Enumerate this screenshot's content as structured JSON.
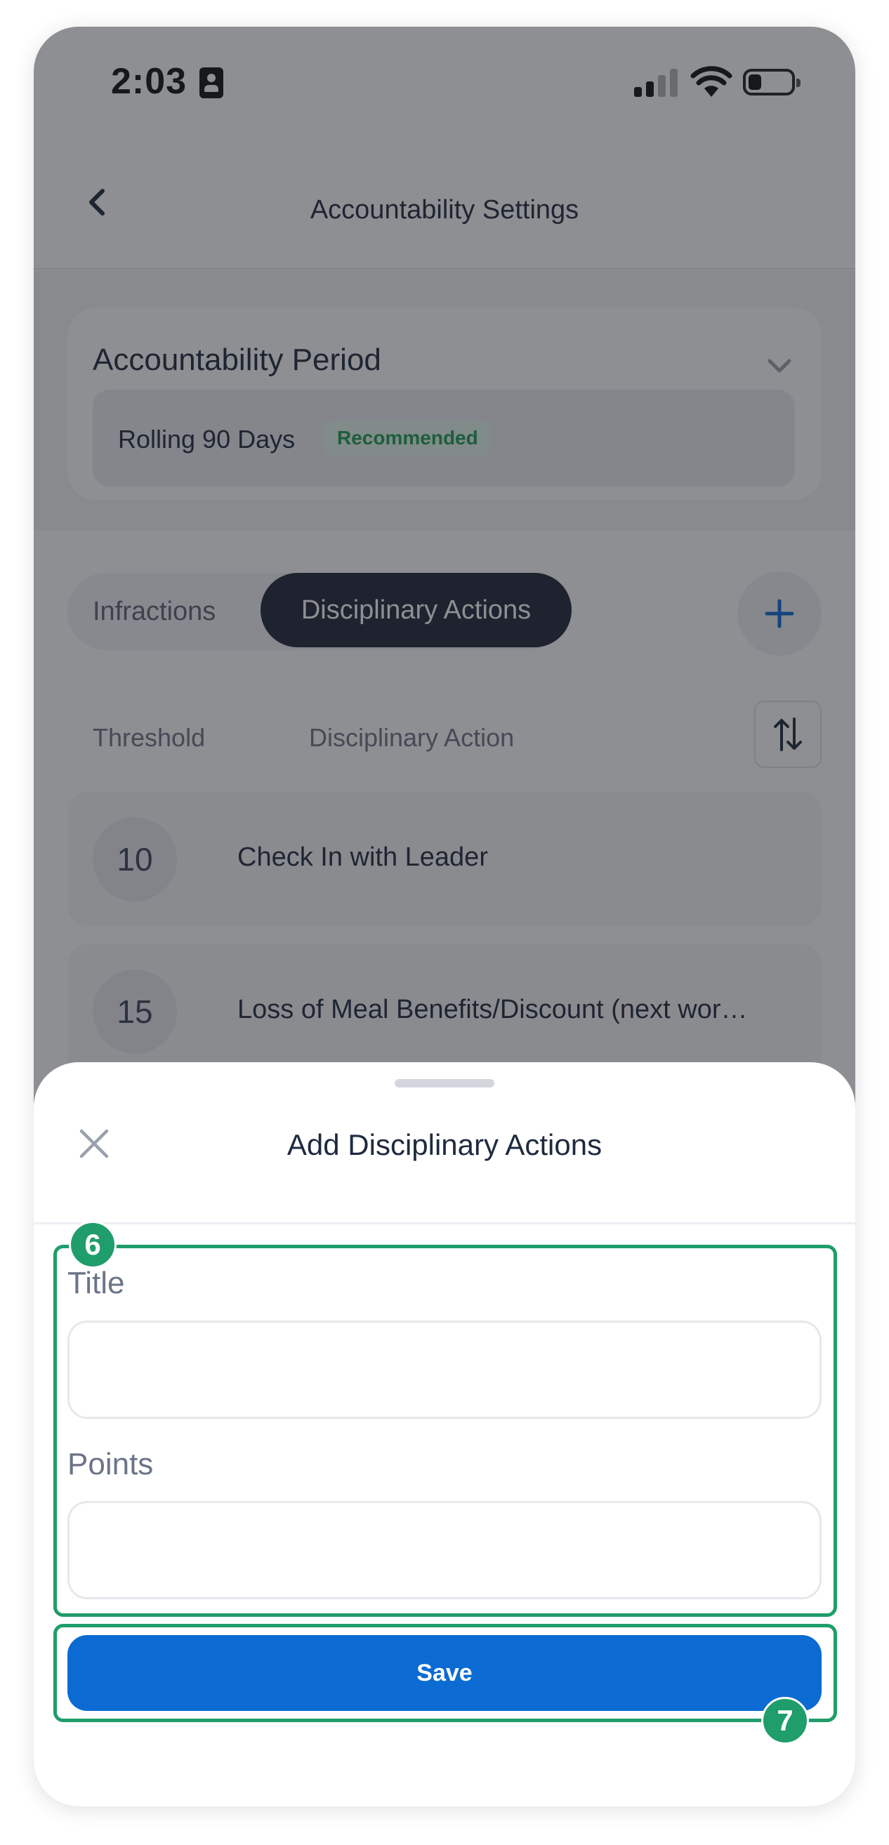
{
  "status_bar": {
    "time": "2:03"
  },
  "header": {
    "title": "Accountability Settings"
  },
  "accountability_period": {
    "title": "Accountability Period",
    "selected_value": "Rolling 90 Days",
    "badge": "Recommended"
  },
  "tabs": [
    {
      "label": "Infractions",
      "active": false
    },
    {
      "label": "Disciplinary Actions",
      "active": true
    }
  ],
  "table": {
    "columns": [
      "Threshold",
      "Disciplinary Action"
    ],
    "rows": [
      {
        "threshold": "10",
        "action": "Check In with Leader"
      },
      {
        "threshold": "15",
        "action": "Loss of Meal Benefits/Discount (next wor…"
      }
    ]
  },
  "sheet": {
    "title": "Add Disciplinary Actions",
    "fields": [
      {
        "label": "Title",
        "value": "",
        "placeholder": ""
      },
      {
        "label": "Points",
        "value": "",
        "placeholder": ""
      }
    ],
    "save_label": "Save"
  },
  "annotations": [
    {
      "number": "6"
    },
    {
      "number": "7"
    }
  ],
  "colors": {
    "accent": "#0b6bd3",
    "dark_tab": "#1e2638",
    "annotation": "#1f9d6a",
    "badge_text": "#1f9a55"
  },
  "icons": [
    "id-card-icon",
    "cellular-signal-icon",
    "wifi-icon",
    "battery-icon",
    "back-chevron-icon",
    "chevron-down-icon",
    "plus-icon",
    "sort-icon",
    "close-icon"
  ]
}
